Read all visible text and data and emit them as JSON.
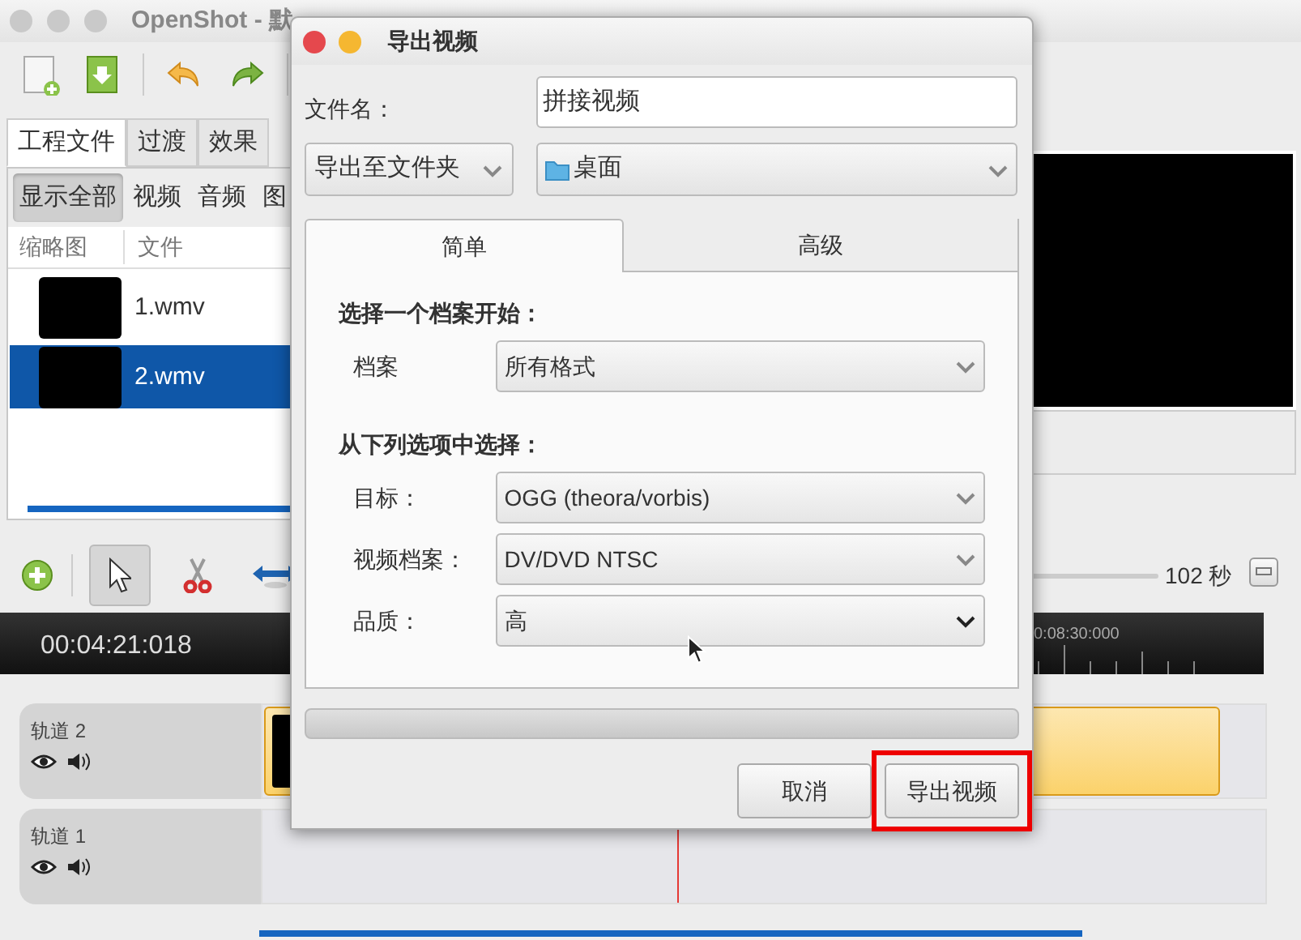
{
  "window": {
    "title": "OpenShot - 默"
  },
  "toolbar": [
    {
      "kind": "new"
    },
    {
      "kind": "import"
    },
    {
      "kind": "sep"
    },
    {
      "kind": "undo"
    },
    {
      "kind": "redo"
    },
    {
      "kind": "sep"
    }
  ],
  "project_tabs": [
    {
      "label": "工程文件",
      "selected": true
    },
    {
      "label": "过渡",
      "selected": false
    },
    {
      "label": "效果",
      "selected": false
    }
  ],
  "filters": [
    {
      "label": "显示全部",
      "selected": true
    },
    {
      "label": "视频",
      "selected": false
    },
    {
      "label": "音频",
      "selected": false
    },
    {
      "label": "图",
      "selected": false
    }
  ],
  "files": {
    "columns": [
      "缩略图",
      "文件"
    ],
    "rows": [
      {
        "name": "1.wmv",
        "selected": false
      },
      {
        "name": "2.wmv",
        "selected": true
      }
    ]
  },
  "timeline": {
    "add_track": {
      "kind": "add"
    },
    "tools": [
      {
        "kind": "pointer",
        "selected": true
      },
      {
        "kind": "razor",
        "selected": false
      },
      {
        "kind": "resize",
        "selected": false
      }
    ],
    "zoom_reading": "102 秒",
    "current_time": "00:04:21:018",
    "ruler_label": "0:08:30:000",
    "tracks": [
      {
        "name": "轨道 2",
        "has_clip": true
      },
      {
        "name": "轨道 1",
        "has_clip": false
      }
    ]
  },
  "dialog": {
    "title": "导出视频",
    "filename_label": "文件名：",
    "filename": "拼接视频",
    "export_to": "导出至文件夹",
    "folder": "桌面",
    "tabs": [
      {
        "label": "简单",
        "selected": true
      },
      {
        "label": "高级",
        "selected": false
      }
    ],
    "sections": [
      {
        "heading": "选择一个档案开始：",
        "fields": [
          {
            "label": "档案",
            "value": "所有格式",
            "focused": false
          }
        ]
      },
      {
        "heading": "从下列选项中选择：",
        "fields": [
          {
            "label": "目标：",
            "value": "OGG (theora/vorbis)",
            "focused": false
          },
          {
            "label": "视频档案：",
            "value": "DV/DVD NTSC",
            "focused": false
          },
          {
            "label": "品质：",
            "value": "高",
            "focused": true
          }
        ]
      }
    ],
    "progress": {
      "level": 0
    },
    "buttons": [
      {
        "label": "取消",
        "highlighted": false
      },
      {
        "label": "导出视频",
        "highlighted": true
      }
    ]
  }
}
